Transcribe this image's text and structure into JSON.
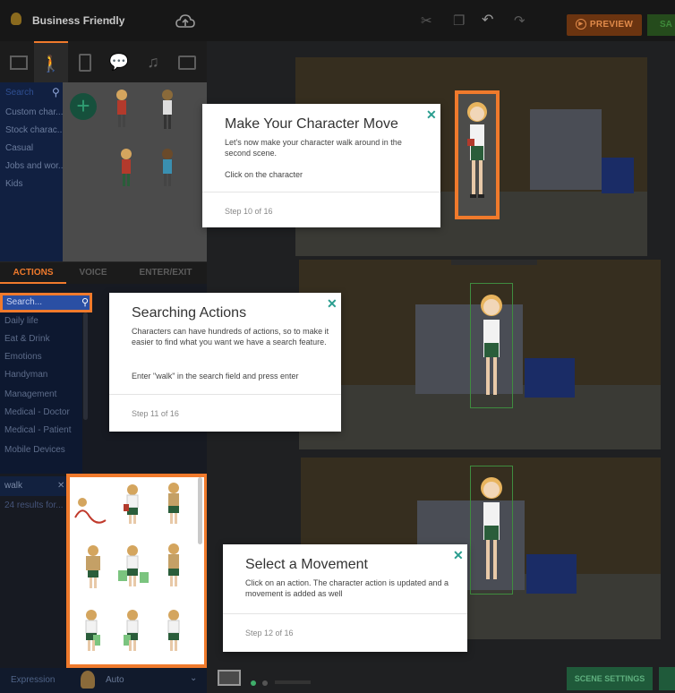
{
  "app": {
    "project_name": "Business Friendly",
    "preview_label": "PREVIEW",
    "save_label": "SA"
  },
  "left_panel": {
    "search_placeholder": "Search",
    "categories": [
      "Custom char...",
      "Stock charac...",
      "Casual",
      "Jobs and wor...",
      "Kids"
    ],
    "action_tabs": [
      "ACTIONS",
      "VOICE",
      "ENTER/EXIT"
    ],
    "action_search_placeholder": "Search...",
    "action_categories": [
      "Daily life",
      "Eat & Drink",
      "Emotions",
      "Handyman",
      "Management",
      "Medical - Doctor",
      "Medical - Patient",
      "Mobile Devices"
    ],
    "walk_query": "walk",
    "results_count": "24 results for...",
    "expression_label": "Expression",
    "expression_value": "Auto"
  },
  "stage": {
    "scene_settings_label": "SCENE SETTINGS"
  },
  "popovers": [
    {
      "title": "Make Your Character Move",
      "body": "Let's now make your character walk around in the second scene.",
      "instruction": "Click on the character",
      "step": "Step 10 of 16"
    },
    {
      "title": "Searching Actions",
      "body": "Characters can have hundreds of actions, so to make it easier to find what you want we have a search feature.",
      "instruction": "Enter \"walk\" in the search field and press enter",
      "step": "Step 11 of 16"
    },
    {
      "title": "Select a Movement",
      "body": "Click on an action. The character action is updated and a movement is added as well",
      "instruction": "",
      "step": "Step 12 of 16"
    }
  ],
  "colors": {
    "highlight": "#f07a2c",
    "accent_teal": "#2a9d8f"
  }
}
